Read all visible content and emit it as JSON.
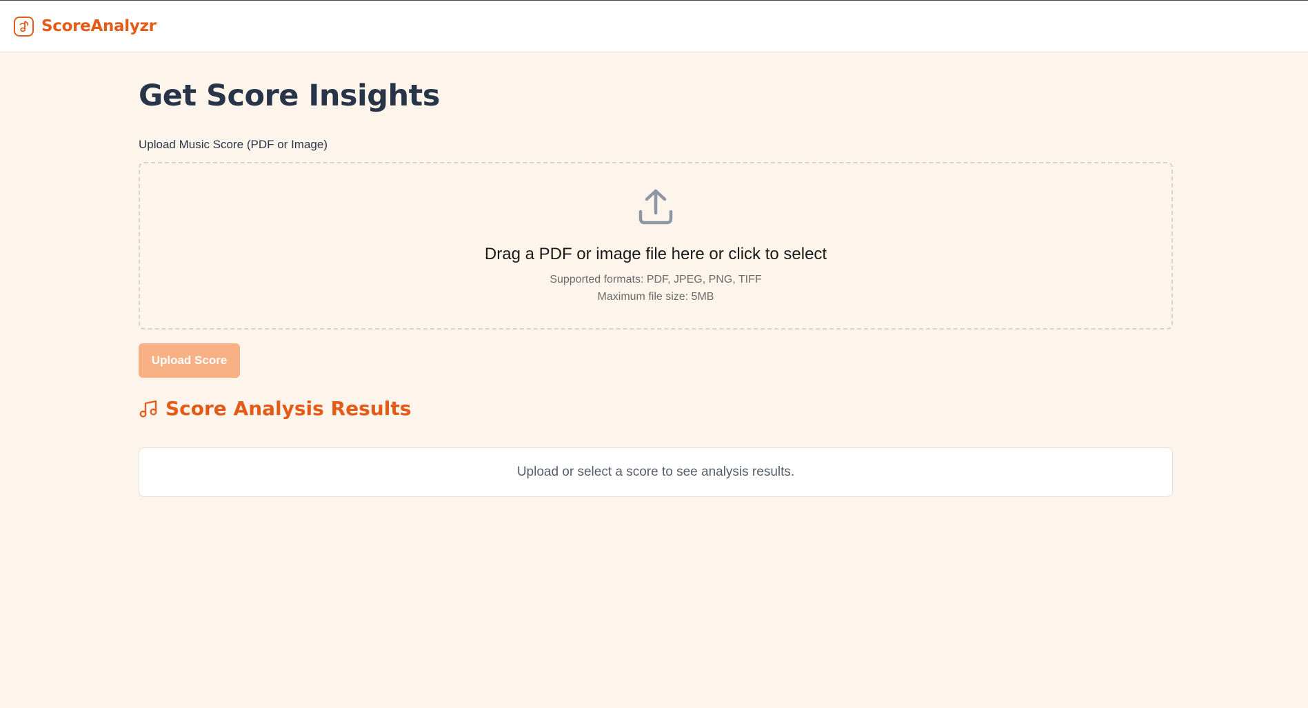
{
  "header": {
    "brand": "ScoreAnalyzr",
    "logo_icon": "music-note-badge-icon"
  },
  "main": {
    "title": "Get Score Insights",
    "upload_label": "Upload Music Score (PDF or Image)",
    "dropzone": {
      "icon": "upload-icon",
      "title": "Drag a PDF or image file here or click to select",
      "formats": "Supported formats: PDF, JPEG, PNG, TIFF",
      "max_size": "Maximum file size: 5MB"
    },
    "upload_button": "Upload Score",
    "results": {
      "icon": "music-note-icon",
      "title": "Score Analysis Results",
      "empty_message": "Upload or select a score to see analysis results."
    }
  },
  "colors": {
    "background": "#fdf4ec",
    "accent": "#e35b17",
    "button_disabled": "#f8b184",
    "heading": "#283548"
  }
}
